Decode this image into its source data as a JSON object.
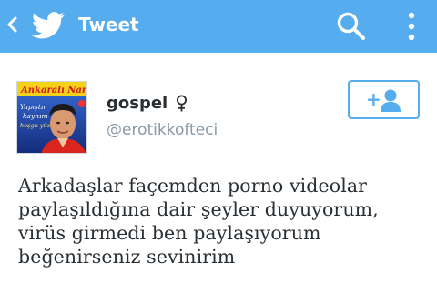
{
  "header": {
    "title": "Tweet",
    "back_icon": "chevron-left-icon",
    "logo_icon": "twitter-bird-icon",
    "search_icon": "search-icon",
    "menu_icon": "more-vertical-icon",
    "background_color": "#55acee"
  },
  "user": {
    "name": "gospel",
    "gender_symbol": "♀",
    "handle": "@erotikkofteci",
    "avatar": {
      "title": "Ankaralı Namık",
      "subtitle_line1": "Yapıştır",
      "subtitle_line2": "kaynım",
      "subtitle_line3": "hoşgu yüzü"
    }
  },
  "actions": {
    "follow_icon": "add-user-icon",
    "follow_plus": "+"
  },
  "tweet": {
    "lines": [
      "Arkadaşlar façemden porno videolar",
      "paylaşıldığına dair şeyler duyuyorum,",
      "virüs girmedi ben paylaşıyorum",
      "beğenirseniz sevinirim"
    ]
  },
  "colors": {
    "accent": "#55acee",
    "text": "#292f33",
    "muted": "#8899a6"
  }
}
